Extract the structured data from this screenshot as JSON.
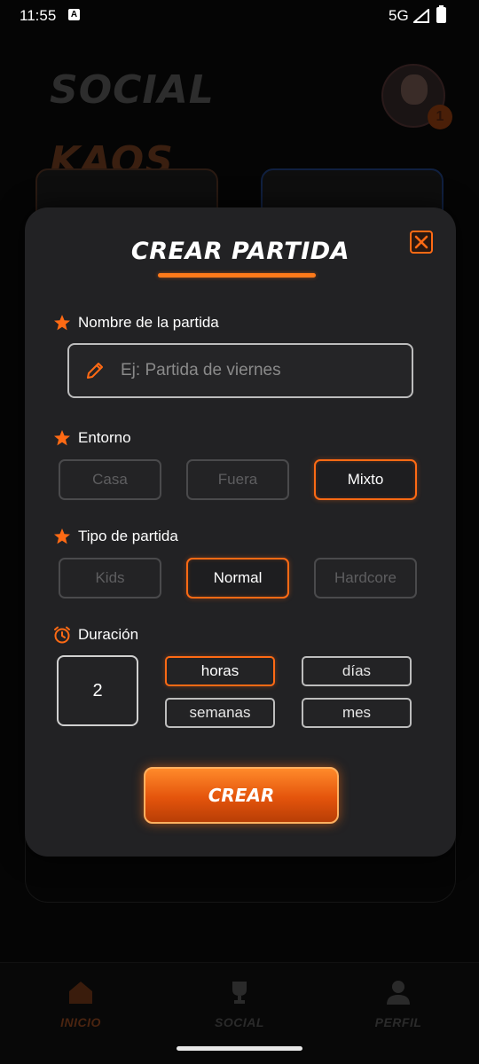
{
  "status_bar": {
    "time": "11:55",
    "notification_icon": "A",
    "network": "5G"
  },
  "header": {
    "logo_part1": "SOCIAL",
    "logo_part2": "KAOS"
  },
  "modal": {
    "title": "CREAR PARTIDA",
    "name_section": {
      "label": "Nombre de la partida",
      "placeholder": "Ej: Partida de viernes",
      "value": ""
    },
    "environment_section": {
      "label": "Entorno",
      "options": [
        "Casa",
        "Fuera",
        "Mixto"
      ],
      "selected": "Mixto"
    },
    "type_section": {
      "label": "Tipo de partida",
      "options": [
        "Kids",
        "Normal",
        "Hardcore"
      ],
      "selected": "Normal"
    },
    "duration_section": {
      "label": "Duración",
      "value": "2",
      "units": [
        "horas",
        "días",
        "semanas",
        "mes"
      ],
      "selected": "horas"
    },
    "create_label": "CREAR"
  },
  "bottom_nav": {
    "items": [
      {
        "label": "INICIO",
        "icon": "home-icon",
        "active": true
      },
      {
        "label": "SOCIAL",
        "icon": "trophy-icon",
        "active": false
      },
      {
        "label": "PERFIL",
        "icon": "person-icon",
        "active": false
      }
    ]
  },
  "colors": {
    "accent": "#ff6a14",
    "modal_bg": "#222224",
    "page_bg": "#050505"
  }
}
